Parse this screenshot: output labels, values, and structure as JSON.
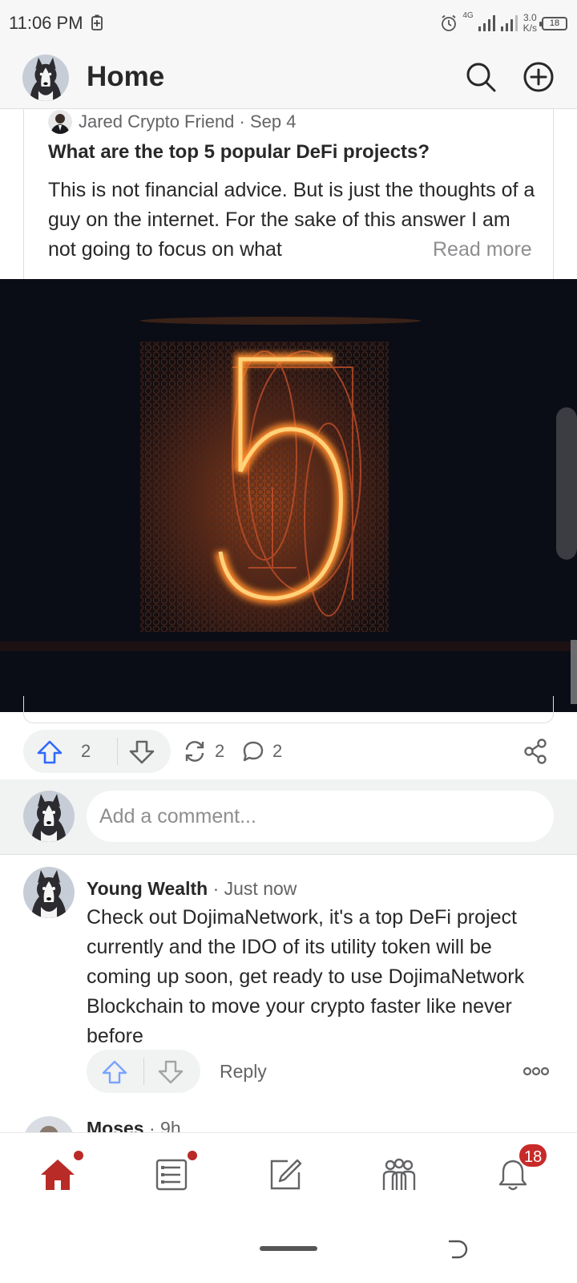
{
  "status_bar": {
    "time": "11:06 PM",
    "network": "4G",
    "speed_value": "3.0",
    "speed_unit": "K/s",
    "battery": "18"
  },
  "header": {
    "title": "Home"
  },
  "post": {
    "author": "Jared Crypto Friend",
    "date": "Sep 4",
    "author_line": "Jared Crypto Friend · Sep 4",
    "title": "What are the top 5 popular DeFi projects?",
    "body": "This is not financial advice. But is just the thoughts of a guy on the internet. For the sake of this answer I am not going to focus on what",
    "read_more": "Read more",
    "image_icon": "nixie-tube-number-5",
    "upvotes": "2",
    "shares": "2",
    "comments": "2"
  },
  "comment_box": {
    "placeholder": "Add a comment..."
  },
  "comments": [
    {
      "author": "Young Wealth",
      "time": "· Just now",
      "text": "Check out DojimaNetwork, it's a top DeFi project currently and the IDO of its utility token will be coming up soon, get ready to use DojimaNetwork Blockchain to move your crypto faster like never before",
      "reply_label": "Reply"
    },
    {
      "author": "Moses",
      "time": "· 9h"
    }
  ],
  "bottom_nav": {
    "notification_count": "18",
    "accent_color": "#b92b27"
  },
  "colors": {
    "upvote_blue": "#2e69ff",
    "text": "#282829",
    "muted": "#636466"
  }
}
